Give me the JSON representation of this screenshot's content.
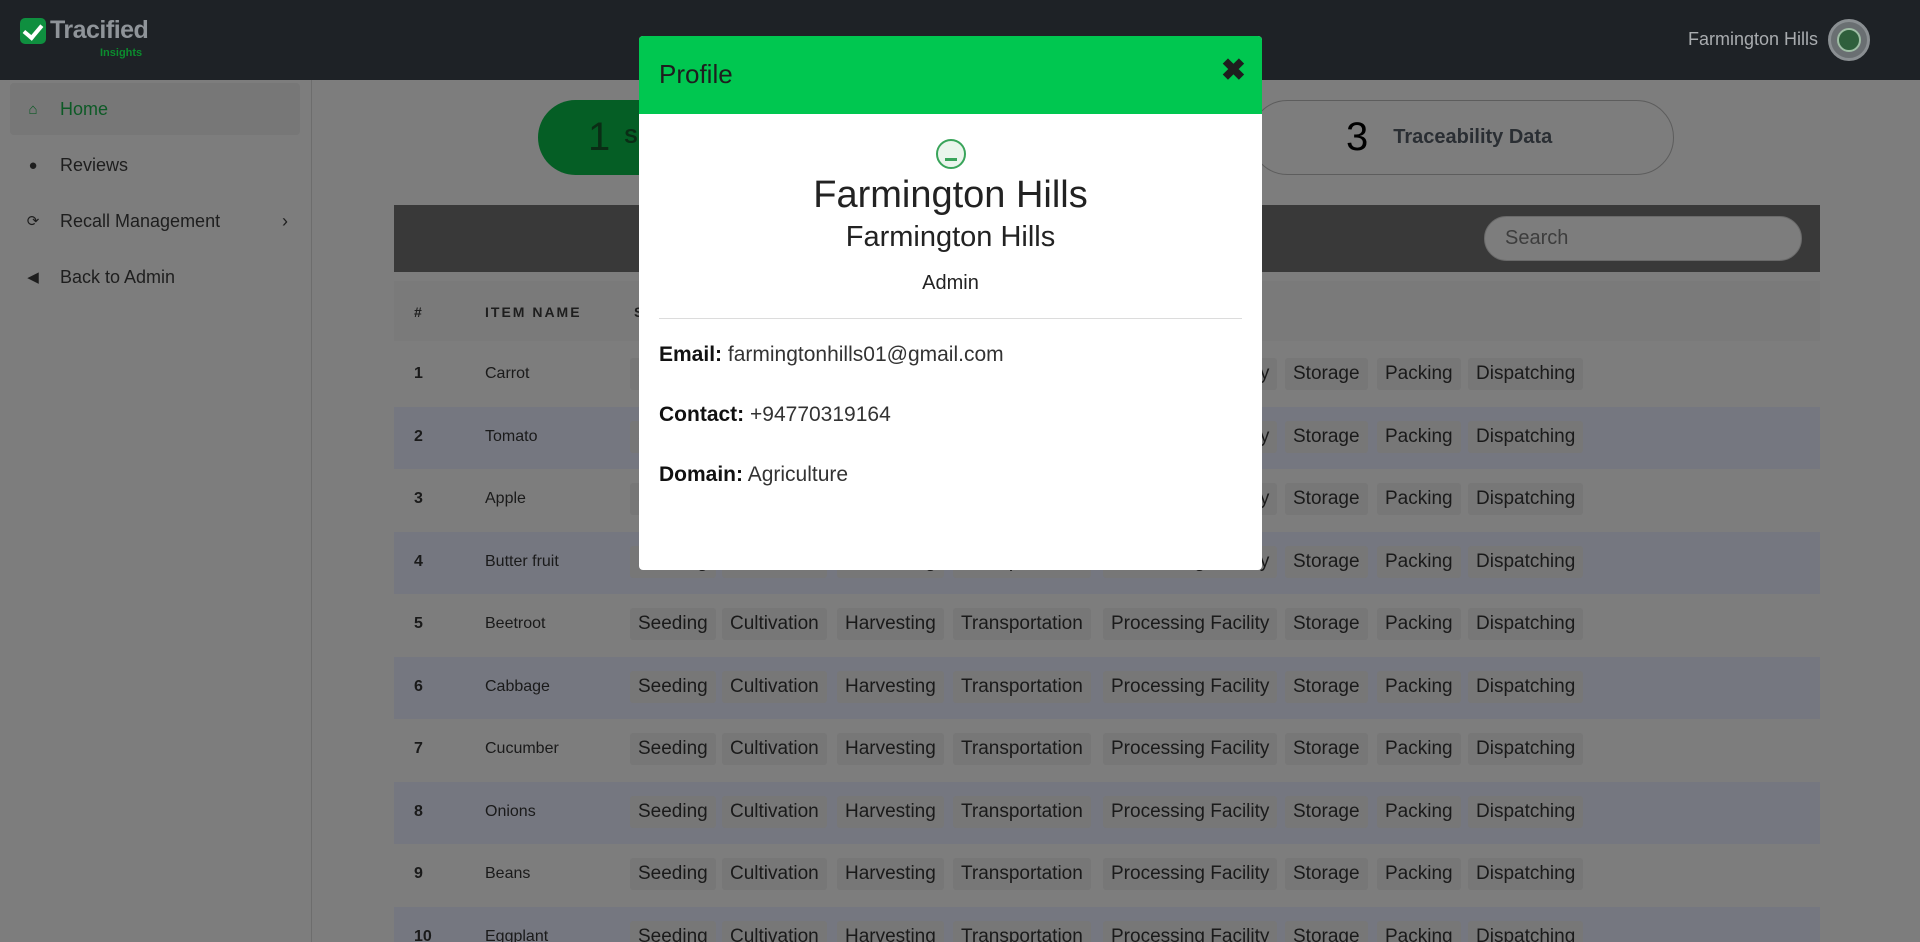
{
  "app": {
    "brand": "Tracified",
    "brand_sub": "Insights",
    "user_name": "Farmington Hills"
  },
  "sidebar": {
    "items": [
      {
        "label": "Home",
        "icon": "home-icon",
        "active": true
      },
      {
        "label": "Reviews",
        "icon": "comment-icon"
      },
      {
        "label": "Recall Management",
        "icon": "refresh-icon",
        "has_children": true
      },
      {
        "label": "Back to Admin",
        "icon": "arrow-circle-left-icon"
      }
    ]
  },
  "stepper": {
    "step1_number": "1",
    "step1_label": "S",
    "step3_number": "3",
    "step3_label": "Traceability Data"
  },
  "table": {
    "search_placeholder": "Search",
    "headers": {
      "num": "#",
      "item": "ITEM NAME",
      "stages": "S"
    },
    "stages": [
      "Seeding",
      "Cultivation",
      "Harvesting",
      "Transportation",
      "Processing Facility",
      "Storage",
      "Packing",
      "Dispatching"
    ],
    "rows": [
      {
        "num": "1",
        "name": "Carrot"
      },
      {
        "num": "2",
        "name": "Tomato"
      },
      {
        "num": "3",
        "name": "Apple"
      },
      {
        "num": "4",
        "name": "Butter fruit"
      },
      {
        "num": "5",
        "name": "Beetroot"
      },
      {
        "num": "6",
        "name": "Cabbage"
      },
      {
        "num": "7",
        "name": "Cucumber"
      },
      {
        "num": "8",
        "name": "Onions"
      },
      {
        "num": "9",
        "name": "Beans"
      },
      {
        "num": "10",
        "name": "Eggplant"
      }
    ],
    "partial_stage_left": "ity"
  },
  "modal": {
    "title": "Profile",
    "name": "Farmington Hills",
    "organization": "Farmington Hills",
    "role": "Admin",
    "email_label": "Email:",
    "email": "farmingtonhills01@gmail.com",
    "contact_label": "Contact:",
    "contact": "+94770319164",
    "domain_label": "Domain:",
    "domain": "Agriculture"
  },
  "colors": {
    "modal_header": "#00c750",
    "topbar": "#1e2226",
    "accent_green": "#0b8d2e"
  }
}
